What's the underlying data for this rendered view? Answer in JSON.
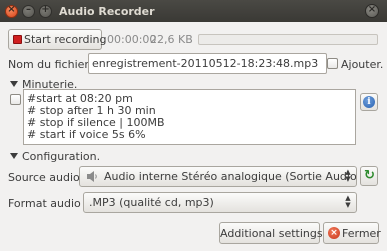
{
  "window": {
    "title": "Audio Recorder",
    "close_glyph": "×",
    "minimize_glyph": "–",
    "maximize_glyph": "+",
    "corner_close_glyph": "×"
  },
  "recording": {
    "start_label": "Start recording",
    "elapsed_time": "00:00:00",
    "file_size": "22,6 KB",
    "progress": 0
  },
  "filename": {
    "label": "Nom du fichier :",
    "value": "enregistrement-20110512-18:23:48.mp3",
    "append_checked": false,
    "append_label": "Ajouter."
  },
  "timer": {
    "section_label": "Minuterie.",
    "expanded": true,
    "enabled": false,
    "lines": [
      "#start at 08:20 pm",
      "# stop after 1 h 30 min",
      "# stop if silence | 100MB",
      "# start if voice 5s 6%"
    ],
    "info_glyph": "i"
  },
  "configuration": {
    "section_label": "Configuration.",
    "expanded": true,
    "source_label": "Source audio:",
    "source_icon": "speaker-icon",
    "source_value": "Audio interne Stéréo analogique (Sortie Audio)",
    "refresh_glyph": "↻",
    "format_label": "Format audio :",
    "format_value": ".MP3  (qualité cd, mp3)"
  },
  "actions": {
    "additional_settings_label": "Additional settings",
    "close_label": "Fermer",
    "close_glyph": "×"
  },
  "colors": {
    "titlebar": "#3c3b37",
    "window_bg": "#f2f1f0",
    "record_red": "#d01f1f",
    "refresh_green": "#2e8b2e",
    "info_blue": "#2861b0"
  }
}
